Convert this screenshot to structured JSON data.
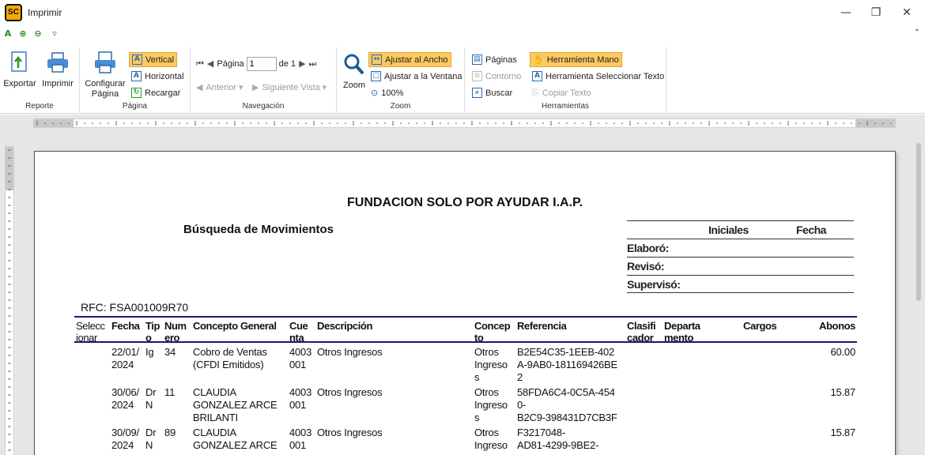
{
  "window": {
    "title": "Imprimir",
    "logo_text": "SC",
    "minimize": "—",
    "restore": "❐",
    "close": "✕"
  },
  "ribbon": {
    "reporte": {
      "label": "Reporte",
      "exportar": "Exportar",
      "imprimir": "Imprimir"
    },
    "pagina": {
      "label": "Página",
      "configurar_line1": "Configurar",
      "configurar_line2": "Página",
      "vertical": "Vertical",
      "horizontal": "Horizontal",
      "recargar": "Recargar"
    },
    "navegacion": {
      "label": "Navegación",
      "pagina_label": "Página",
      "page_value": "1",
      "de_label": "de 1",
      "anterior": "Anterior",
      "siguiente": "Siguiente Vista"
    },
    "zoom": {
      "label": "Zoom",
      "zoom": "Zoom",
      "ajustar_ancho": "Ajustar al Ancho",
      "ajustar_ventana": "Ajustar a la Ventana",
      "cien": "100%"
    },
    "herramientas": {
      "label": "Herramientas",
      "paginas": "Páginas",
      "contorno": "Contorno",
      "buscar": "Buscar",
      "mano": "Herramienta Mano",
      "seleccionar": "Herramienta Seleccionar Texto",
      "copiar": "Copiar Texto"
    }
  },
  "report": {
    "org_name": "FUNDACION SOLO POR AYUDAR I.A.P.",
    "title": "Búsqueda de Movimientos",
    "signatures": {
      "iniciales": "Iniciales",
      "fecha": "Fecha",
      "elaboro": "Elaboró:",
      "reviso": "Revisó:",
      "superviso": "Supervisó:"
    },
    "rfc": "RFC: FSA001009R70",
    "headers": {
      "seleccionar": "Selecc\nionar",
      "fecha": "Fecha",
      "tipo": "Tip\no",
      "numero": "Num\nero",
      "concepto_general": "Concepto General",
      "cuenta": "Cue\nnta",
      "descripcion": "Descripción",
      "concepto": "Concep\nto",
      "referencia": "Referencia",
      "clasificador": "Clasifi\ncador",
      "departamento": "Departa\nmento",
      "cargos": "Cargos",
      "abonos": "Abonos"
    },
    "rows": [
      {
        "fecha": "22/01/\n2024",
        "tipo": "Ig",
        "numero": "34",
        "concepto_general": "Cobro de Ventas\n(CFDI Emitidos)",
        "cuenta": "4003\n001",
        "descripcion": "Otros Ingresos",
        "concepto": "Otros\nIngreso\ns",
        "referencia": "B2E54C35-1EEB-402\nA-9AB0-181169426BE\n2",
        "abonos": "60.00"
      },
      {
        "fecha": "30/06/\n2024",
        "tipo": "Dr\nN",
        "numero": "11",
        "concepto_general": "CLAUDIA\nGONZALEZ ARCE\nBRILANTI",
        "cuenta": "4003\n001",
        "descripcion": "Otros Ingresos",
        "concepto": "Otros\nIngreso\ns",
        "referencia": "58FDA6C4-0C5A-454\n0-\nB2C9-398431D7CB3F",
        "abonos": "15.87"
      },
      {
        "fecha": "30/09/\n2024",
        "tipo": "Dr\nN",
        "numero": "89",
        "concepto_general": "CLAUDIA\nGONZALEZ ARCE",
        "cuenta": "4003\n001",
        "descripcion": "Otros Ingresos",
        "concepto": "Otros\nIngreso",
        "referencia": "F3217048-\nAD81-4299-9BE2-",
        "abonos": "15.87"
      }
    ]
  },
  "colors": {
    "active_button": "#fcc862",
    "table_rule": "#1a1a6e",
    "preview_bg": "#e6e6e6"
  }
}
